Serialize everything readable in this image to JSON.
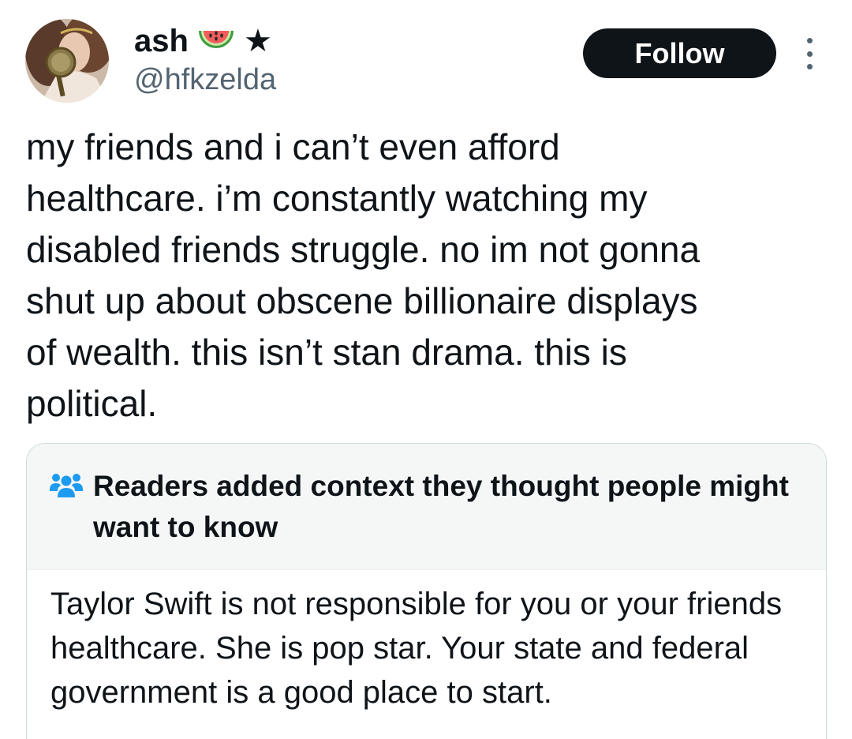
{
  "author": {
    "display_name": "ash",
    "name_emoji": "watermelon-icon",
    "name_symbol": "★",
    "handle": "@hfkzelda"
  },
  "actions": {
    "follow_label": "Follow",
    "more_icon": "more-options-icon"
  },
  "tweet": {
    "text": "my friends and i can’t even afford\nhealthcare. i’m constantly watching my\ndisabled friends struggle. no im not gonna\nshut up about obscene billionaire displays\nof wealth. this isn’t stan drama. this is\npolitical."
  },
  "community_note": {
    "icon": "people-icon",
    "title": "Readers added context they thought people might want to know",
    "body": "Taylor Swift is not responsible for you or your friends healthcare. She is pop star. Your state and federal government is a good place to start."
  },
  "colors": {
    "text_primary": "#0f1419",
    "text_secondary": "#536471",
    "button_bg": "#0f1419",
    "note_accent": "#1d9bf0",
    "note_header_bg": "#f5f7f7"
  }
}
